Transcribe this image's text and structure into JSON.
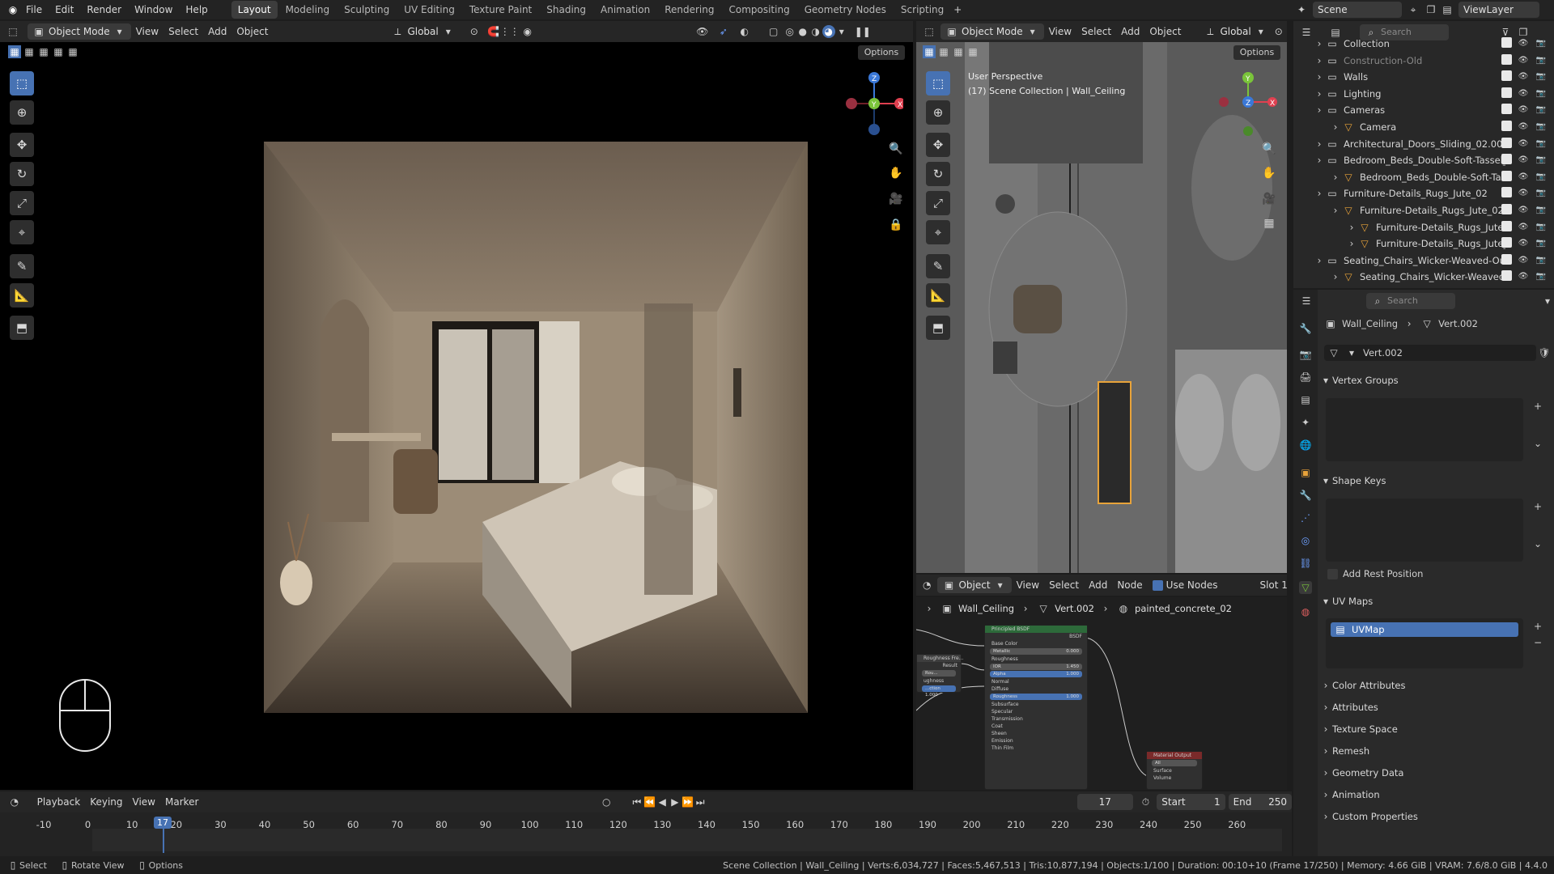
{
  "topbar": {
    "menus": [
      "File",
      "Edit",
      "Render",
      "Window",
      "Help"
    ],
    "workspaces": [
      "Layout",
      "Modeling",
      "Sculpting",
      "UV Editing",
      "Texture Paint",
      "Shading",
      "Animation",
      "Rendering",
      "Compositing",
      "Geometry Nodes",
      "Scripting"
    ],
    "active_workspace": "Layout",
    "scene": "Scene",
    "view_layer": "ViewLayer"
  },
  "viewport_left": {
    "mode": "Object Mode",
    "menus": [
      "View",
      "Select",
      "Add",
      "Object"
    ],
    "orientation": "Global",
    "options": "Options"
  },
  "viewport_right": {
    "mode": "Object Mode",
    "menus": [
      "View",
      "Select",
      "Add",
      "Object"
    ],
    "orientation": "Global",
    "options": "Options",
    "info_line1": "User Perspective",
    "info_line2": "(17) Scene Collection | Wall_Ceiling"
  },
  "outliner": {
    "search_placeholder": "Search",
    "rows": [
      {
        "label": "Collection",
        "indent": 0
      },
      {
        "label": "Construction-Old",
        "indent": 0
      },
      {
        "label": "Walls",
        "indent": 0
      },
      {
        "label": "Lighting",
        "indent": 0
      },
      {
        "label": "Cameras",
        "indent": 0
      },
      {
        "label": "Camera",
        "indent": 1
      },
      {
        "label": "Architectural_Doors_Sliding_02.001",
        "indent": 0
      },
      {
        "label": "Bedroom_Beds_Double-Soft-Tassel_01.",
        "indent": 0
      },
      {
        "label": "Bedroom_Beds_Double-Soft-Tassel_",
        "indent": 1
      },
      {
        "label": "Furniture-Details_Rugs_Jute_02",
        "indent": 0
      },
      {
        "label": "Furniture-Details_Rugs_Jute_02.001",
        "indent": 1
      },
      {
        "label": "Furniture-Details_Rugs_Jute",
        "indent": 2
      },
      {
        "label": "Furniture-Details_Rugs_Jute_02.",
        "indent": 2
      },
      {
        "label": "Seating_Chairs_Wicker-Weaved-Outdo",
        "indent": 0
      },
      {
        "label": "Seating_Chairs_Wicker-Weaved-Ou",
        "indent": 1
      }
    ]
  },
  "properties": {
    "search_placeholder": "Search",
    "breadcrumb_object": "Wall_Ceiling",
    "breadcrumb_mesh": "Vert.002",
    "mesh_name": "Vert.002",
    "sections": {
      "vertex_groups": "Vertex Groups",
      "shape_keys": "Shape Keys",
      "add_rest_position": "Add Rest Position",
      "uv_maps": "UV Maps",
      "uv_map_item": "UVMap",
      "collapsed": [
        "Color Attributes",
        "Attributes",
        "Texture Space",
        "Remesh",
        "Geometry Data",
        "Animation",
        "Custom Properties"
      ]
    }
  },
  "node_editor": {
    "mode": "Object",
    "menus": [
      "View",
      "Select",
      "Add",
      "Node"
    ],
    "use_nodes": "Use Nodes",
    "slot": "Slot 1",
    "crumb_object": "Wall_Ceiling",
    "crumb_mesh": "Vert.002",
    "crumb_material": "painted_concrete_02",
    "bsdf_title": "Principled BSDF",
    "bsdf_out": "BSDF",
    "bsdf_rows": [
      "Base Color",
      "Metallic",
      "Roughness",
      "IOR",
      "Alpha",
      "Normal",
      "Diffuse",
      "Roughness",
      "Subsurface",
      "Specular",
      "Transmission",
      "Coat",
      "Sheen",
      "Emission",
      "Thin Film"
    ],
    "bsdf_values": {
      "metallic": "0.000",
      "ior": "1.450",
      "alpha": "1.000",
      "roughness2": "1.000"
    },
    "output_title": "Material Output",
    "output_target": "All",
    "output_rows": [
      "Surface",
      "Volume"
    ],
    "left_node_rows": [
      "Roughness Fre...",
      "Result",
      "Rou...",
      "ughness",
      "...ction 1.000"
    ]
  },
  "timeline": {
    "menus": [
      "Playback",
      "Keying",
      "View",
      "Marker"
    ],
    "current_frame": "17",
    "start_label": "Start",
    "start": "1",
    "end_label": "End",
    "end": "250",
    "ticks": [
      "-10",
      "0",
      "10",
      "20",
      "30",
      "40",
      "50",
      "60",
      "70",
      "80",
      "90",
      "100",
      "110",
      "120",
      "130",
      "140",
      "150",
      "160",
      "170",
      "180",
      "190",
      "200",
      "210",
      "220",
      "230",
      "240",
      "250",
      "260"
    ]
  },
  "statusbar": {
    "select": "Select",
    "rotate": "Rotate View",
    "options": "Options",
    "stats": "Scene Collection | Wall_Ceiling | Verts:6,034,727 | Faces:5,467,513 | Tris:10,877,194 | Objects:1/100 | Duration: 00:10+10 (Frame 17/250) | Memory: 4.66 GiB | VRAM: 7.6/8.0 GiB | 4.4.0"
  },
  "colors": {
    "accent": "#4772b3",
    "orange": "#e8a33a",
    "bg": "#1d1d1d"
  }
}
